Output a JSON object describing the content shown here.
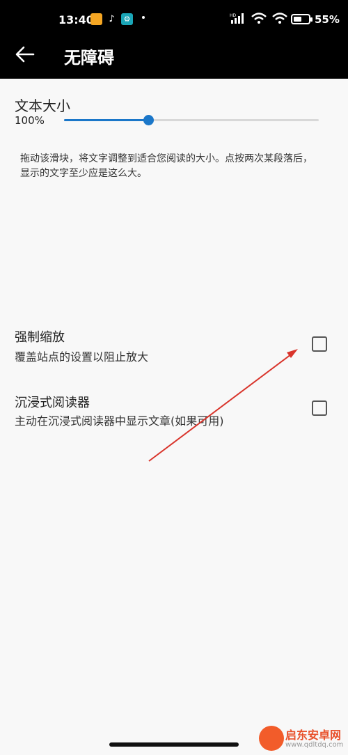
{
  "status_bar": {
    "time": "13:40",
    "battery": "55%",
    "battery_level": 0.55,
    "hd_badge": "HD"
  },
  "header": {
    "title": "无障碍"
  },
  "text_size": {
    "title": "文本大小",
    "value": "100%",
    "slider_position": 0.33,
    "description": "拖动该滑块，将文字调整到适合您阅读的大小。点按两次某段落后，显示的文字至少应是这么大。"
  },
  "force_zoom": {
    "title": "强制缩放",
    "subtitle": "覆盖站点的设置以阻止放大",
    "checked": false
  },
  "immersive_reader": {
    "title": "沉浸式阅读器",
    "subtitle": "主动在沉浸式阅读器中显示文章(如果可用)",
    "checked": false
  },
  "watermark": {
    "name": "启东安卓网",
    "url": "www.qdltdq.com"
  },
  "colors": {
    "accent": "#1b77c9",
    "annotation_arrow": "#d9342b"
  }
}
